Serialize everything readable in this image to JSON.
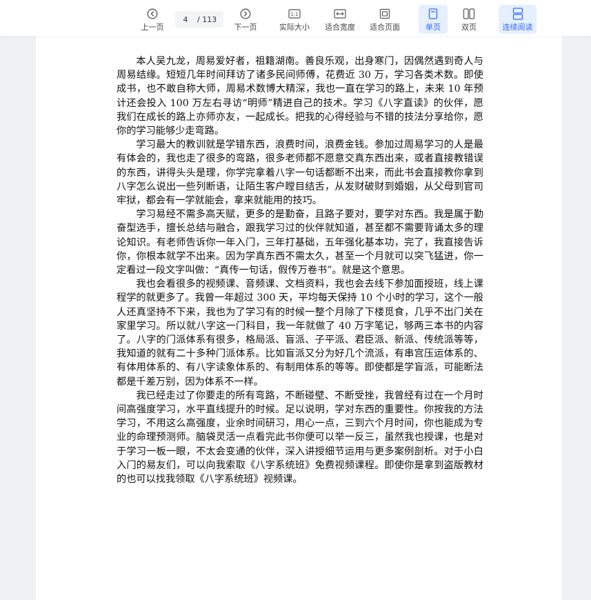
{
  "toolbar": {
    "prev_label": "上一页",
    "next_label": "下一页",
    "current_page": "4",
    "total_pages": "/ 113",
    "actual_size_label": "实际大小",
    "fit_width_label": "适合宽度",
    "fit_page_label": "适合页面",
    "single_page_label": "单页",
    "double_page_label": "双页",
    "continuous_label": "连续阅读",
    "actual_size_icon_text": "1:1",
    "accent_color": "#2f6bff"
  },
  "document": {
    "heading_fragment": "…",
    "paragraphs": [
      "本人吴九龙，周易爱好者，祖籍湖南。善良乐观，出身寒门，因偶然遇到奇人与周易结缘。短短几年时间拜访了诸多民间师傅，花费近 30 万，学习各类术数。即使成书，也不敢自称大师，周易术数博大精深，我也一直在学习的路上，未来 10 年预计还会投入 100 万左右寻访“明师”精进自己的技术。学习《八字直读》的伙伴，愿我们在成长的路上亦师亦友，一起成长。把我的心得经验与不错的技法分享给你，愿你的学习能够少走弯路。",
      "学习最大的教训就是学错东西，浪费时间，浪费金钱。参加过周易学习的人是最有体会的，我也走了很多的弯路，很多老师都不愿意交真东西出来，或者直接教错误的东西，讲得头头是理，你学完拿着八字一句话都断不出来，而此书会直接教你拿到八字怎么说出一些列断语，让陌生客户瞠目结舌，从发财破财到婚姻，从父母到官司牢狱，都会有一学就能会，拿来就能用的技巧。",
      "学习易经不需多高天赋，更多的是勤奋，且路子要对，要学对东西。我是属于勤奋型选手，擅长总结与融合，跟我学习过的伙伴就知道，甚至都不需要背诵太多的理论知识。有老师告诉你一年入门，三年打基础，五年强化基本功，完了，我直接告诉你，你根本就学不出来。因为学真东西不需太久，甚至一个月就可以突飞猛进，你一定看过一段文字叫做：“真传一句话，假传万卷书”。就是这个意思。",
      "我也会看很多的视频课、音频课、文档资料，我也会去线下参加面授班，线上课程学的就更多了。我曾一年超过 300 天，平均每天保持 10 个小时的学习，这个一般人还真坚持不下来，我也为了学习有的时候一整个月除了下楼觅食，几乎不出门关在家里学习。所以就八字这一门科目，我一年就做了 40 万字笔记，够两三本书的内容了。八字的门派体系有很多，格局派、盲派、子平派、君臣派、新派、传统派等等，我知道的就有二十多种门派体系。比如盲派又分为好几个流派，有串宫压运体系的、有体用体系的、有八字读象体系的、有制用体系的等等。即使都是学盲派，可能断法都是千差万别，因为体系不一样。",
      "我已经走过了你要走的所有弯路，不断碰壁、不断受挫，我曾经有过在一个月时间高强度学习，水平直线提升的时候。足以说明，学对东西的重要性。你按我的方法学习，不用这么高强度，业余时间研习，用心一点，三到六个月时间，你也能成为专业的命理预测师。脑袋灵活一点看完此书你便可以举一反三，虽然我也授课，也是对于学习一板一眼，不太会变通的伙伴，深入讲授细节运用与更多案例剖析。对于小白入门的易友们，可以向我索取《八字系统班》免费视频课程。即使你是拿到盗版教材的也可以找我领取《八字系统班》视频课。"
    ]
  }
}
